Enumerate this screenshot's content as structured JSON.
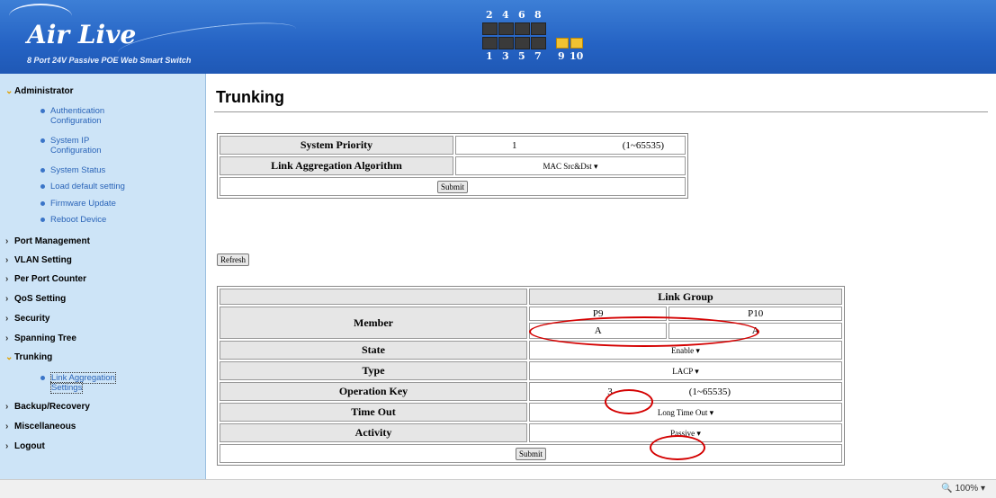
{
  "header": {
    "logo_text": "Air Live",
    "subtitle": "8 Port 24V Passive POE Web Smart Switch",
    "ports_top": [
      "2",
      "4",
      "6",
      "8"
    ],
    "ports_bottom": [
      "1",
      "3",
      "5",
      "7"
    ],
    "fiber_ports": [
      "9",
      "10"
    ]
  },
  "sidebar": {
    "sections": [
      {
        "label": "Administrator",
        "open": true
      },
      {
        "label": "Port Management"
      },
      {
        "label": "VLAN Setting"
      },
      {
        "label": "Per Port Counter"
      },
      {
        "label": "QoS Setting"
      },
      {
        "label": "Security"
      },
      {
        "label": "Spanning Tree"
      },
      {
        "label": "Trunking",
        "open": true
      },
      {
        "label": "Backup/Recovery"
      },
      {
        "label": "Miscellaneous"
      },
      {
        "label": "Logout"
      }
    ],
    "admin_items": [
      {
        "line1": "Authentication",
        "line2": "Configuration"
      },
      {
        "line1": "System IP",
        "line2": "Configuration"
      },
      {
        "line1": "System Status",
        "line2": ""
      },
      {
        "line1": "Load default setting",
        "line2": ""
      },
      {
        "line1": "Firmware Update",
        "line2": ""
      },
      {
        "line1": "Reboot Device",
        "line2": ""
      }
    ],
    "trunk_items": [
      {
        "line1": "Link Aggregation",
        "line2": "Settings"
      }
    ]
  },
  "page": {
    "title": "Trunking",
    "system_priority_label": "System Priority",
    "system_priority_value": "1",
    "system_priority_range": "(1~65535)",
    "algorithm_label": "Link Aggregation Algorithm",
    "algorithm_value": "MAC Src&Dst",
    "submit_label": "Submit",
    "refresh_label": "Refresh"
  },
  "link_table": {
    "header": "Link Group",
    "member_label": "Member",
    "ports": [
      "P9",
      "P10"
    ],
    "port_groups": [
      "A",
      "A"
    ],
    "state_label": "State",
    "state_value": "Enable",
    "type_label": "Type",
    "type_value": "LACP",
    "opkey_label": "Operation Key",
    "opkey_value": "3",
    "opkey_range": "(1~65535)",
    "timeout_label": "Time Out",
    "timeout_value": "Long Time Out",
    "activity_label": "Activity",
    "activity_value": "Passive",
    "submit_label": "Submit"
  },
  "statusbar": {
    "zoom": "100%"
  }
}
